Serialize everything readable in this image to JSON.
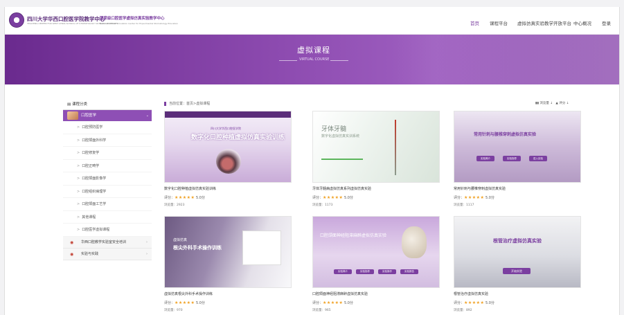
{
  "header": {
    "school_name": "四川大学华西口腔医学院教学中心",
    "school_name_en": "TEACHING CENTER FOR WEST CHINA SCHOOL OF STOMATOLOGY SICHUAN UNIVERSITY",
    "center_name": "国家级口腔医学虚拟仿真实验教学中心",
    "center_name_en": "National Virtual Simulation Center for Experimental Stomatology Education",
    "nav": [
      "首页",
      "课程平台",
      "虚拟仿真实验教学开放平台",
      "中心概况",
      "登录"
    ]
  },
  "banner": {
    "title": "虚拟课程",
    "subtitle": "VIRTUAL COURSE"
  },
  "sidebar": {
    "heading": "课程分类",
    "active_category": "口腔医学",
    "items": [
      "口腔预防医学",
      "口腔颌面外科学",
      "口腔修复学",
      "口腔正畸学",
      "口腔颌面影像学",
      "口腔组织病理学",
      "口腔颌面工艺学",
      "其他课程",
      "口腔医学虚拟课程"
    ],
    "other_categories": [
      "华西口腔教学实验室安全培训",
      "实验与实践"
    ]
  },
  "breadcrumb": "当前位置：首页>虚拟课程",
  "sort": {
    "by_views": "浏览量",
    "by_score": "评分"
  },
  "cards": [
    {
      "name": "数字化口腔种植虚拟仿真实验训练",
      "score_label": "评分：",
      "stars": "★★★★★",
      "score": "5.0分",
      "views_label": "浏览量：",
      "views": "2923",
      "overlay_title": "数字化口腔种植虚拟仿真实验训练",
      "overlay_school": "四川大学华西口腔医学院"
    },
    {
      "name": "牙体牙髓病虚拟仿真系列虚拟仿真实验",
      "score_label": "评分：",
      "stars": "★★★★★",
      "score": "5.0分",
      "views_label": "浏览量：",
      "views": "1173",
      "overlay_title": "牙体牙髓",
      "overlay_sub": "数字化虚拟仿真实训系统"
    },
    {
      "name": "常用针刺与腰椎穿刺虚拟仿真实验",
      "score_label": "评分：",
      "stars": "★★★★★",
      "score": "5.0分",
      "views_label": "浏览量：",
      "views": "1117",
      "overlay_title": "常用针刺与腰椎穿刺虚拟仿真实验",
      "buttons": [
        "实验简介",
        "实验指导",
        "进入实验"
      ]
    },
    {
      "name": "虚拟仿真根尖外科手术操作训练",
      "score_label": "评分：",
      "stars": "★★★★★",
      "score": "5.0分",
      "views_label": "浏览量：",
      "views": "970",
      "overlay_title": "虚拟仿真",
      "overlay_sub": "根尖外科手术操作训练"
    },
    {
      "name": "口腔颌面神经阻滞麻醉虚拟仿真实验",
      "score_label": "评分：",
      "stars": "★★★★★",
      "score": "5.0分",
      "views_label": "浏览量：",
      "views": "965",
      "overlay_title": "口腔颌面神经阻滞麻醉虚拟仿真实验",
      "buttons": [
        "实验简介",
        "实验指导",
        "实验操作",
        "实验报告"
      ]
    },
    {
      "name": "根管治疗虚拟仿真实验",
      "score_label": "评分：",
      "stars": "★★★★★",
      "score": "5.0分",
      "views_label": "浏览量：",
      "views": "892",
      "overlay_title": "根管治疗虚拟仿真实验",
      "button": "开始实验"
    }
  ],
  "colors": {
    "brand": "#7b3fa0",
    "star": "#f0a020"
  }
}
